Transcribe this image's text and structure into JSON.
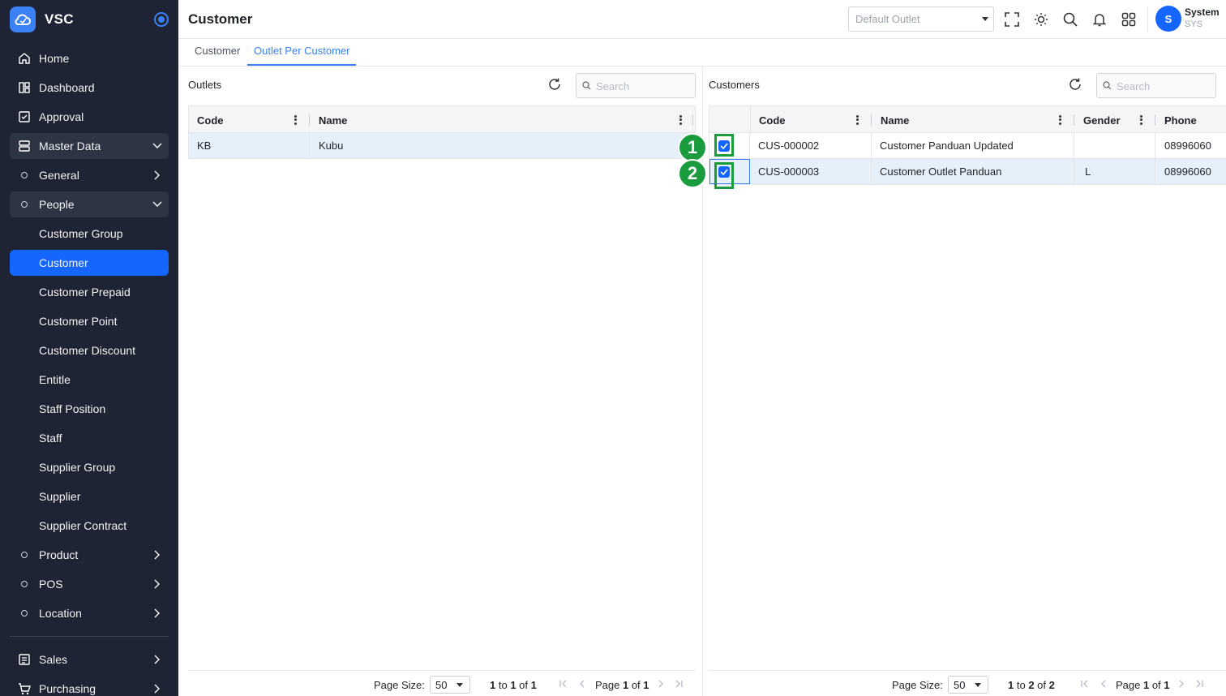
{
  "app": {
    "name": "VSC"
  },
  "sidebar": {
    "items": [
      {
        "label": "Home"
      },
      {
        "label": "Dashboard"
      },
      {
        "label": "Approval"
      },
      {
        "label": "Master Data"
      },
      {
        "label": "General"
      },
      {
        "label": "People"
      },
      {
        "label": "Customer Group"
      },
      {
        "label": "Customer"
      },
      {
        "label": "Customer Prepaid"
      },
      {
        "label": "Customer Point"
      },
      {
        "label": "Customer Discount"
      },
      {
        "label": "Entitle"
      },
      {
        "label": "Staff Position"
      },
      {
        "label": "Staff"
      },
      {
        "label": "Supplier Group"
      },
      {
        "label": "Supplier"
      },
      {
        "label": "Supplier Contract"
      },
      {
        "label": "Product"
      },
      {
        "label": "POS"
      },
      {
        "label": "Location"
      },
      {
        "label": "Sales"
      },
      {
        "label": "Purchasing"
      }
    ]
  },
  "header": {
    "title": "Customer",
    "outlet_placeholder": "Default Outlet",
    "user": {
      "initial": "S",
      "name": "System",
      "code": "SYS"
    }
  },
  "tabs": [
    {
      "label": "Customer",
      "active": false
    },
    {
      "label": "Outlet Per Customer",
      "active": true
    }
  ],
  "outlets": {
    "title": "Outlets",
    "search_placeholder": "Search",
    "columns": [
      "Code",
      "Name"
    ],
    "rows": [
      [
        "KB",
        "Kubu"
      ]
    ],
    "footer": {
      "page_size_label": "Page Size:",
      "page_size": "50",
      "range_from": "1",
      "range_to": "1",
      "total": "1",
      "page": "1",
      "pages": "1"
    }
  },
  "customers": {
    "title": "Customers",
    "search_placeholder": "Search",
    "columns": [
      "Code",
      "Name",
      "Gender",
      "Phone"
    ],
    "rows": [
      [
        "CUS-000002",
        "Customer Panduan Updated",
        "",
        "08996060"
      ],
      [
        "CUS-000003",
        "Customer Outlet Panduan",
        "L",
        "08996060"
      ]
    ],
    "footer": {
      "page_size_label": "Page Size:",
      "page_size": "50",
      "range_from": "1",
      "range_to": "2",
      "total": "2",
      "page": "1",
      "pages": "1"
    }
  },
  "annotations": {
    "badge_1": "1",
    "badge_2": "2"
  },
  "colors": {
    "sidebar_bg": "#1e2433",
    "accent": "#1565ff",
    "highlight": "#1a9c3e",
    "tab_active": "#3b82f6"
  }
}
